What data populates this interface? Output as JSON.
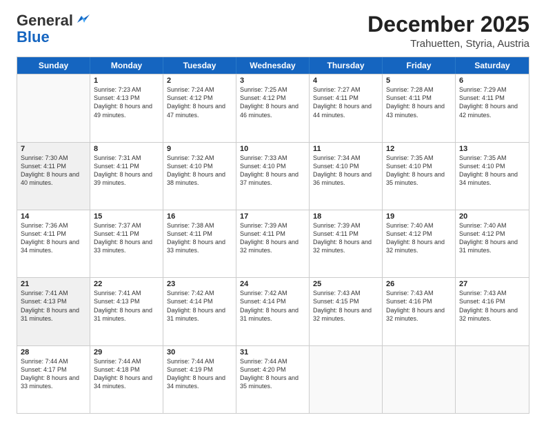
{
  "logo": {
    "general": "General",
    "blue": "Blue"
  },
  "header": {
    "title": "December 2025",
    "subtitle": "Trahuetten, Styria, Austria"
  },
  "days": [
    "Sunday",
    "Monday",
    "Tuesday",
    "Wednesday",
    "Thursday",
    "Friday",
    "Saturday"
  ],
  "weeks": [
    [
      {
        "day": "",
        "sunrise": "",
        "sunset": "",
        "daylight": "",
        "empty": true
      },
      {
        "day": "1",
        "sunrise": "Sunrise: 7:23 AM",
        "sunset": "Sunset: 4:13 PM",
        "daylight": "Daylight: 8 hours and 49 minutes."
      },
      {
        "day": "2",
        "sunrise": "Sunrise: 7:24 AM",
        "sunset": "Sunset: 4:12 PM",
        "daylight": "Daylight: 8 hours and 47 minutes."
      },
      {
        "day": "3",
        "sunrise": "Sunrise: 7:25 AM",
        "sunset": "Sunset: 4:12 PM",
        "daylight": "Daylight: 8 hours and 46 minutes."
      },
      {
        "day": "4",
        "sunrise": "Sunrise: 7:27 AM",
        "sunset": "Sunset: 4:11 PM",
        "daylight": "Daylight: 8 hours and 44 minutes."
      },
      {
        "day": "5",
        "sunrise": "Sunrise: 7:28 AM",
        "sunset": "Sunset: 4:11 PM",
        "daylight": "Daylight: 8 hours and 43 minutes."
      },
      {
        "day": "6",
        "sunrise": "Sunrise: 7:29 AM",
        "sunset": "Sunset: 4:11 PM",
        "daylight": "Daylight: 8 hours and 42 minutes."
      }
    ],
    [
      {
        "day": "7",
        "sunrise": "Sunrise: 7:30 AM",
        "sunset": "Sunset: 4:11 PM",
        "daylight": "Daylight: 8 hours and 40 minutes.",
        "shaded": true
      },
      {
        "day": "8",
        "sunrise": "Sunrise: 7:31 AM",
        "sunset": "Sunset: 4:11 PM",
        "daylight": "Daylight: 8 hours and 39 minutes."
      },
      {
        "day": "9",
        "sunrise": "Sunrise: 7:32 AM",
        "sunset": "Sunset: 4:10 PM",
        "daylight": "Daylight: 8 hours and 38 minutes."
      },
      {
        "day": "10",
        "sunrise": "Sunrise: 7:33 AM",
        "sunset": "Sunset: 4:10 PM",
        "daylight": "Daylight: 8 hours and 37 minutes."
      },
      {
        "day": "11",
        "sunrise": "Sunrise: 7:34 AM",
        "sunset": "Sunset: 4:10 PM",
        "daylight": "Daylight: 8 hours and 36 minutes."
      },
      {
        "day": "12",
        "sunrise": "Sunrise: 7:35 AM",
        "sunset": "Sunset: 4:10 PM",
        "daylight": "Daylight: 8 hours and 35 minutes."
      },
      {
        "day": "13",
        "sunrise": "Sunrise: 7:35 AM",
        "sunset": "Sunset: 4:10 PM",
        "daylight": "Daylight: 8 hours and 34 minutes."
      }
    ],
    [
      {
        "day": "14",
        "sunrise": "Sunrise: 7:36 AM",
        "sunset": "Sunset: 4:11 PM",
        "daylight": "Daylight: 8 hours and 34 minutes."
      },
      {
        "day": "15",
        "sunrise": "Sunrise: 7:37 AM",
        "sunset": "Sunset: 4:11 PM",
        "daylight": "Daylight: 8 hours and 33 minutes."
      },
      {
        "day": "16",
        "sunrise": "Sunrise: 7:38 AM",
        "sunset": "Sunset: 4:11 PM",
        "daylight": "Daylight: 8 hours and 33 minutes."
      },
      {
        "day": "17",
        "sunrise": "Sunrise: 7:39 AM",
        "sunset": "Sunset: 4:11 PM",
        "daylight": "Daylight: 8 hours and 32 minutes."
      },
      {
        "day": "18",
        "sunrise": "Sunrise: 7:39 AM",
        "sunset": "Sunset: 4:11 PM",
        "daylight": "Daylight: 8 hours and 32 minutes."
      },
      {
        "day": "19",
        "sunrise": "Sunrise: 7:40 AM",
        "sunset": "Sunset: 4:12 PM",
        "daylight": "Daylight: 8 hours and 32 minutes."
      },
      {
        "day": "20",
        "sunrise": "Sunrise: 7:40 AM",
        "sunset": "Sunset: 4:12 PM",
        "daylight": "Daylight: 8 hours and 31 minutes."
      }
    ],
    [
      {
        "day": "21",
        "sunrise": "Sunrise: 7:41 AM",
        "sunset": "Sunset: 4:13 PM",
        "daylight": "Daylight: 8 hours and 31 minutes.",
        "shaded": true
      },
      {
        "day": "22",
        "sunrise": "Sunrise: 7:41 AM",
        "sunset": "Sunset: 4:13 PM",
        "daylight": "Daylight: 8 hours and 31 minutes."
      },
      {
        "day": "23",
        "sunrise": "Sunrise: 7:42 AM",
        "sunset": "Sunset: 4:14 PM",
        "daylight": "Daylight: 8 hours and 31 minutes."
      },
      {
        "day": "24",
        "sunrise": "Sunrise: 7:42 AM",
        "sunset": "Sunset: 4:14 PM",
        "daylight": "Daylight: 8 hours and 31 minutes."
      },
      {
        "day": "25",
        "sunrise": "Sunrise: 7:43 AM",
        "sunset": "Sunset: 4:15 PM",
        "daylight": "Daylight: 8 hours and 32 minutes."
      },
      {
        "day": "26",
        "sunrise": "Sunrise: 7:43 AM",
        "sunset": "Sunset: 4:16 PM",
        "daylight": "Daylight: 8 hours and 32 minutes."
      },
      {
        "day": "27",
        "sunrise": "Sunrise: 7:43 AM",
        "sunset": "Sunset: 4:16 PM",
        "daylight": "Daylight: 8 hours and 32 minutes."
      }
    ],
    [
      {
        "day": "28",
        "sunrise": "Sunrise: 7:44 AM",
        "sunset": "Sunset: 4:17 PM",
        "daylight": "Daylight: 8 hours and 33 minutes."
      },
      {
        "day": "29",
        "sunrise": "Sunrise: 7:44 AM",
        "sunset": "Sunset: 4:18 PM",
        "daylight": "Daylight: 8 hours and 34 minutes."
      },
      {
        "day": "30",
        "sunrise": "Sunrise: 7:44 AM",
        "sunset": "Sunset: 4:19 PM",
        "daylight": "Daylight: 8 hours and 34 minutes."
      },
      {
        "day": "31",
        "sunrise": "Sunrise: 7:44 AM",
        "sunset": "Sunset: 4:20 PM",
        "daylight": "Daylight: 8 hours and 35 minutes."
      },
      {
        "day": "",
        "sunrise": "",
        "sunset": "",
        "daylight": "",
        "empty": true
      },
      {
        "day": "",
        "sunrise": "",
        "sunset": "",
        "daylight": "",
        "empty": true
      },
      {
        "day": "",
        "sunrise": "",
        "sunset": "",
        "daylight": "",
        "empty": true
      }
    ]
  ]
}
